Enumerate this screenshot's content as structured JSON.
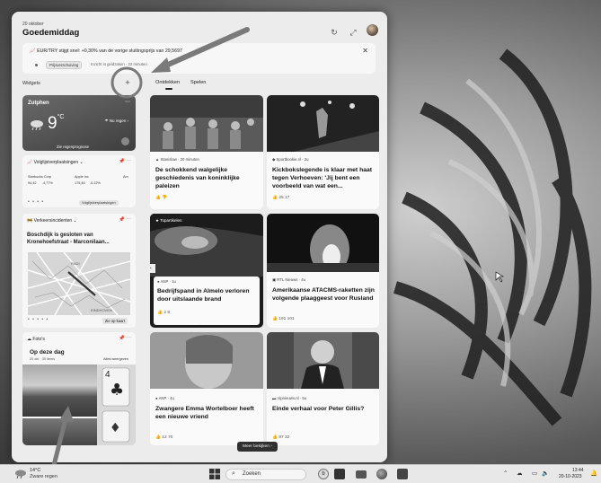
{
  "header": {
    "date": "20 oktober",
    "greeting": "Goedemiddag"
  },
  "ticker": {
    "text": "EUR/TRY stijgt snel: +0,30% van de vorige sluitingsprijs van 29,5697",
    "tag": "Prijsverschuiving",
    "meta": "Inzicht in geldzaken · 22 minuten"
  },
  "widgets_label": "Widgets",
  "tabs": [
    "Ontdekken",
    "Spelen"
  ],
  "weather": {
    "city": "Zutphen",
    "temp": "9",
    "unit": "°C",
    "now_label": "Nu regen",
    "forecast_label": "Zie regenprognose"
  },
  "stocks": {
    "title": "Volglijstverplaatsingen",
    "items": [
      {
        "name": "Starbucks Corp",
        "price": "94,42",
        "change": "-4,77%"
      },
      {
        "name": "Apple Inc",
        "price": "175,46",
        "change": "-0,22%"
      },
      {
        "name": "Am",
        "price": "",
        "change": ""
      }
    ],
    "button": "Volglijstverplaatsingen"
  },
  "traffic": {
    "title_label": "Verkeersincidenten",
    "headline": "Boschdijk is gesloten van Kronehoefstraat - Marconilaan...",
    "route_button": "Zie op kaart",
    "map_labels": [
      "RADI",
      "EINDHOVEN"
    ]
  },
  "photos": {
    "app": "Foto's",
    "title": "Op deze dag",
    "subtitle": "20 okt · 30 items",
    "view_all": "Alles weergeven"
  },
  "news": [
    {
      "source": "Stanislaw · 20 minuten",
      "headline": "De schokkend walgelijke geschiedenis van koninklijke paleizen",
      "reacts": ""
    },
    {
      "source": "Sportbookie.nl · 2u",
      "headline": "Kickbokslegende is klaar met haat tegen Verhoeven: 'Jij bent een voorbeeld van wat een...",
      "reacts": "25   17"
    },
    {
      "label": "Topartikelen",
      "source": "ANP · 1u",
      "headline": "Bedrijfspand in Almelo verloren door uitslaande brand",
      "reacts": "2   8"
    },
    {
      "source": "RTL Nieuws · 4u",
      "headline": "Amerikaanse ATACMS-raketten zijn volgende plaaggeest voor Rusland",
      "reacts": "191   101"
    },
    {
      "source": "ANP · 4u",
      "headline": "Zwangere Emma Wortelboer heeft een nieuwe vriend",
      "reacts": "12   70"
    },
    {
      "source": "Vipnieuws.nl · 5u",
      "headline": "Einde verhaal voor Peter Gillis?",
      "reacts": "87   32"
    }
  ],
  "more_button": "Meer bekijken",
  "taskbar": {
    "temp": "14°C",
    "condition": "Zware regen",
    "search_label": "Zoeken",
    "time": "13:44",
    "date": "20-10-2023"
  },
  "colors": {
    "panel_bg": "#ececec",
    "taskbar_bg": "#e8e8e8",
    "annotation": "#777777"
  }
}
